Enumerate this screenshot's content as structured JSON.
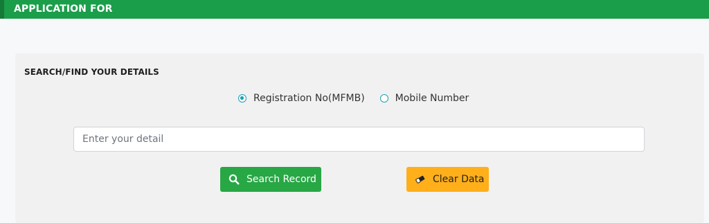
{
  "header": {
    "title": "APPLICATION FOR"
  },
  "search_panel": {
    "heading": "SEARCH/FIND YOUR DETAILS",
    "radio_options": [
      {
        "label": "Registration No(MFMB)",
        "checked": true
      },
      {
        "label": "Mobile Number",
        "checked": false
      }
    ],
    "input": {
      "value": "",
      "placeholder": "Enter your detail"
    },
    "search_button": {
      "label": "Search Record",
      "icon": "search-icon"
    },
    "clear_button": {
      "label": "Clear Data",
      "icon": "eraser-icon"
    }
  },
  "colors": {
    "header_green": "#1a9e4a",
    "search_button_green": "#28a745",
    "clear_button_orange": "#ffaf1a",
    "radio_accent": "#17a2b8"
  }
}
